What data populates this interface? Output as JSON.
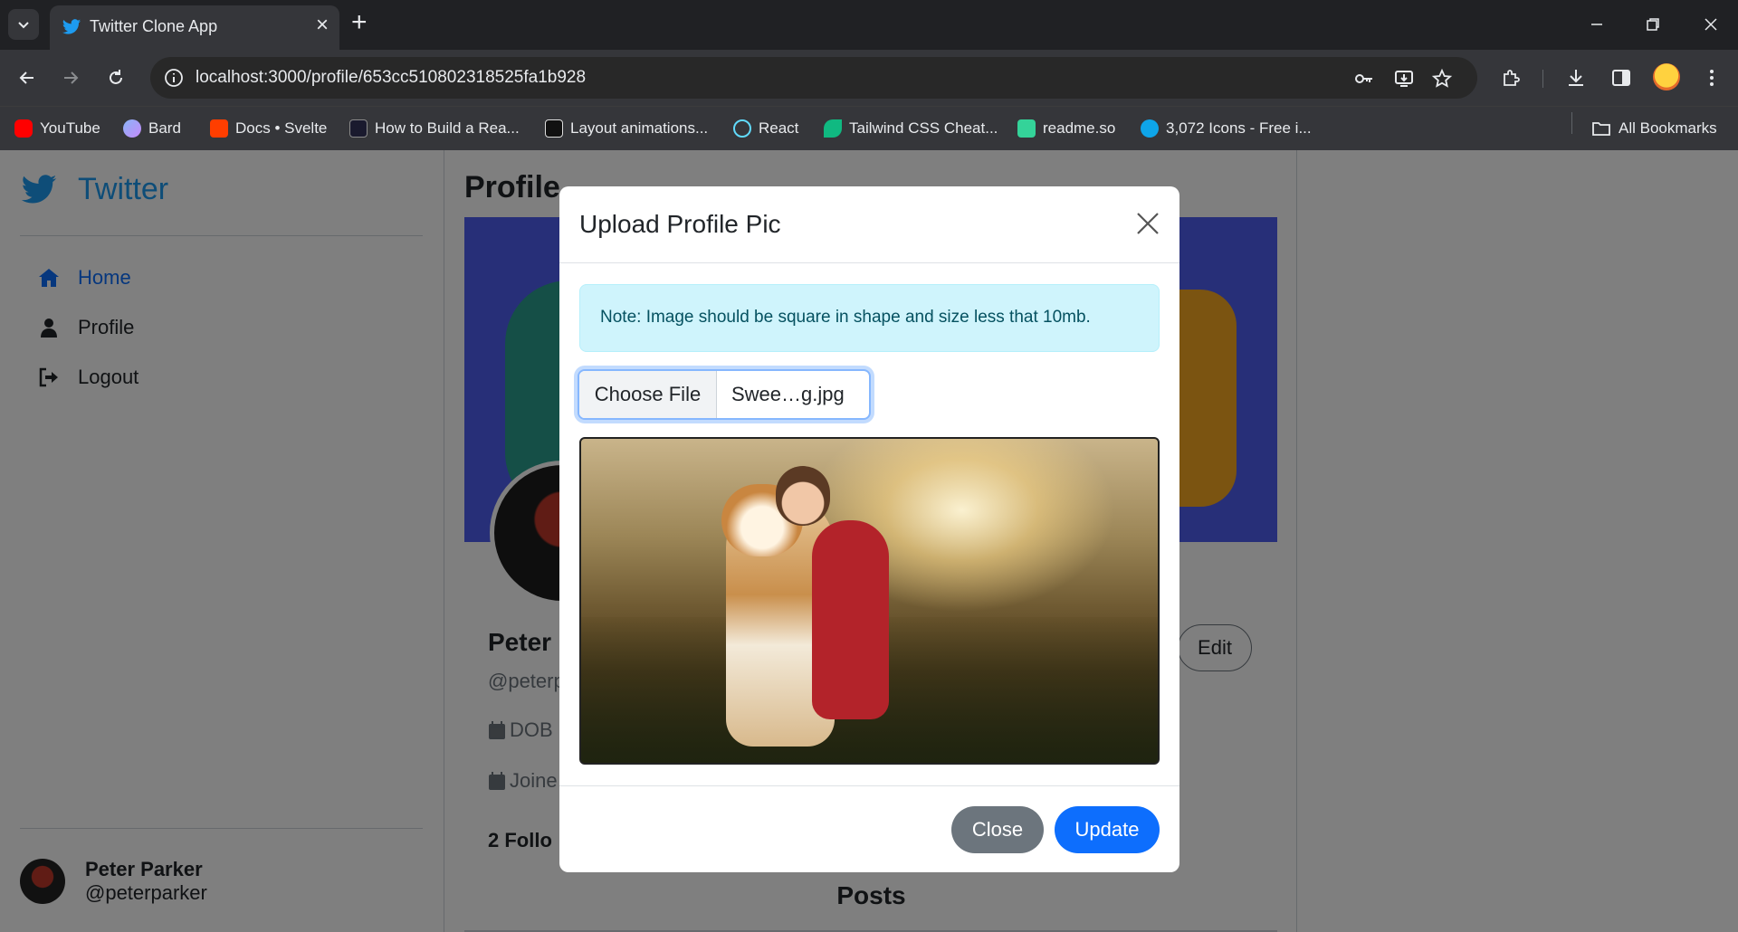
{
  "browser": {
    "tab_title": "Twitter Clone App",
    "url": "localhost:3000/profile/653cc510802318525fa1b928",
    "bookmarks": [
      {
        "label": "YouTube",
        "color": "#ff0000"
      },
      {
        "label": "Bard",
        "color": "#8ab4f8"
      },
      {
        "label": "Docs • Svelte",
        "color": "#ff3e00"
      },
      {
        "label": "How to Build a Rea...",
        "color": "#1a1a2e"
      },
      {
        "label": "Layout animations...",
        "color": "#ffffff"
      },
      {
        "label": "React",
        "color": "#61dafb"
      },
      {
        "label": "Tailwind CSS Cheat...",
        "color": "#38bdf8"
      },
      {
        "label": "readme.so",
        "color": "#34d399"
      },
      {
        "label": "3,072 Icons - Free i...",
        "color": "#0ea5e9"
      }
    ],
    "all_bookmarks": "All Bookmarks"
  },
  "sidebar": {
    "brand": "Twitter",
    "nav": [
      {
        "label": "Home",
        "icon": "home-icon",
        "active": true
      },
      {
        "label": "Profile",
        "icon": "user-icon",
        "active": false
      },
      {
        "label": "Logout",
        "icon": "logout-icon",
        "active": false
      }
    ],
    "user": {
      "name": "Peter Parker",
      "handle": "@peterparker"
    }
  },
  "profile": {
    "title": "Profile",
    "name_partial": "Peter",
    "handle_partial": "@peterp",
    "dob_partial": "DOB",
    "joined_partial": "Joine",
    "follow_partial": "2 Follo",
    "edit_label": "Edit",
    "posts_title": "Posts"
  },
  "modal": {
    "title": "Upload Profile Pic",
    "note": "Note: Image should be square in shape and size less that 10mb.",
    "choose_file_label": "Choose File",
    "file_name": "Swee…g.jpg",
    "close_label": "Close",
    "update_label": "Update"
  },
  "colors": {
    "accent": "#0d6efd",
    "twitter_blue": "#1d9bf0",
    "alert_bg": "#cff4fc",
    "secondary": "#6c757d"
  }
}
